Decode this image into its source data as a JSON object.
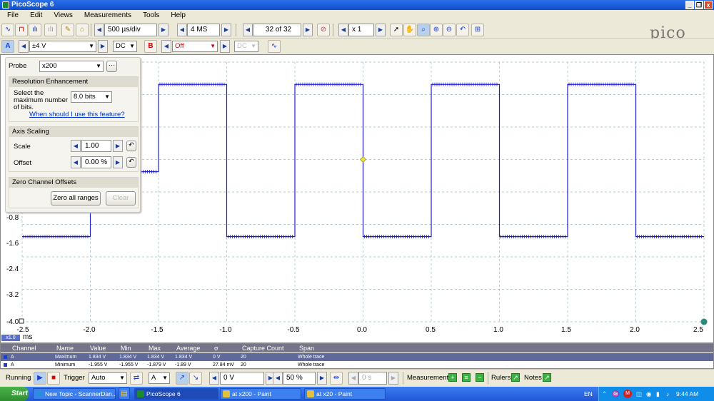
{
  "window": {
    "title": "PicoScope 6"
  },
  "menu": [
    "File",
    "Edit",
    "Views",
    "Measurements",
    "Tools",
    "Help"
  ],
  "toolbar": {
    "timebase": "500 µs/div",
    "samples": "4 MS",
    "buffer": "32 of 32",
    "zoom": "x 1"
  },
  "channel_bar": {
    "a_label": "A",
    "a_range": "±4 V",
    "a_coupling": "DC",
    "b_label": "B",
    "b_range": "Off",
    "b_coupling": "DC"
  },
  "panel": {
    "probe_label": "Probe",
    "probe_value": "x200",
    "resolution_header": "Resolution Enhancement",
    "resolution_text": "Select the maximum number of bits.",
    "resolution_value": "8.0 bits",
    "resolution_link": "When should I use this feature?",
    "axis_header": "Axis Scaling",
    "scale_label": "Scale",
    "scale_value": "1.00",
    "offset_label": "Offset",
    "offset_value": "0.00 %",
    "zero_header": "Zero Channel Offsets",
    "zero_button": "Zero all ranges",
    "clear_button": "Clear"
  },
  "chart_data": {
    "type": "line",
    "xlabel": "ms",
    "xlim": [
      -2.5,
      2.5
    ],
    "ylim": [
      -4.0,
      2.4
    ],
    "x_ticks": [
      "-2.5",
      "-2.0",
      "-1.5",
      "-1.0",
      "-0.5",
      "0.0",
      "0.5",
      "1.0",
      "1.5",
      "2.0",
      "2.5"
    ],
    "y_ticks": [
      "-0.8",
      "-1.6",
      "-2.4",
      "-3.2",
      "-4.0"
    ],
    "grid": true,
    "color": "#1f1fd0",
    "series": [
      {
        "name": "A",
        "x": [
          -2.5,
          -2.0,
          -2.0,
          -1.5,
          -1.5,
          -1.0,
          -1.0,
          -0.5,
          -0.5,
          0.0,
          0.0,
          0.5,
          0.5,
          1.0,
          1.0,
          1.5,
          1.5,
          2.0,
          2.0,
          2.5
        ],
        "y": [
          -1.9,
          -1.9,
          -0.3,
          -0.3,
          1.85,
          1.85,
          -1.9,
          -1.9,
          1.85,
          1.85,
          -1.9,
          -1.9,
          1.85,
          1.85,
          -1.9,
          -1.9,
          1.85,
          1.85,
          -1.9,
          -1.9
        ]
      }
    ],
    "trigger_marker": {
      "x": 0.0,
      "y": -0.0
    }
  },
  "plot_labels": {
    "ms_unit": "x1.0",
    "axis_unit": "ms"
  },
  "measurements": {
    "headers": [
      "Channel",
      "Name",
      "Value",
      "Min",
      "Max",
      "Average",
      "σ",
      "Capture Count",
      "Span"
    ],
    "rows": [
      [
        "A",
        "Maximum",
        "1.834 V",
        "1.834 V",
        "1.834 V",
        "1.834 V",
        "0 V",
        "20",
        "Whole trace"
      ],
      [
        "A",
        "Minimum",
        "-1.955 V",
        "-1.955 V",
        "-1.879 V",
        "-1.89 V",
        "27.84 mV",
        "20",
        "Whole trace"
      ]
    ]
  },
  "bottombar": {
    "running": "Running",
    "trigger_label": "Trigger",
    "trigger_mode": "Auto",
    "trigger_channel": "A",
    "threshold": "0 V",
    "pre_trigger": "50 %",
    "delay": "0 s",
    "measurements_label": "Measurements",
    "rulers_label": "Rulers",
    "notes_label": "Notes"
  },
  "taskbar": {
    "start": "Start",
    "tasks": [
      "New Topic - ScannerDan...",
      "PicoScope 6",
      "at x200 - Paint",
      "at x20 - Paint"
    ],
    "lang": "EN",
    "time": "9:44 AM"
  }
}
